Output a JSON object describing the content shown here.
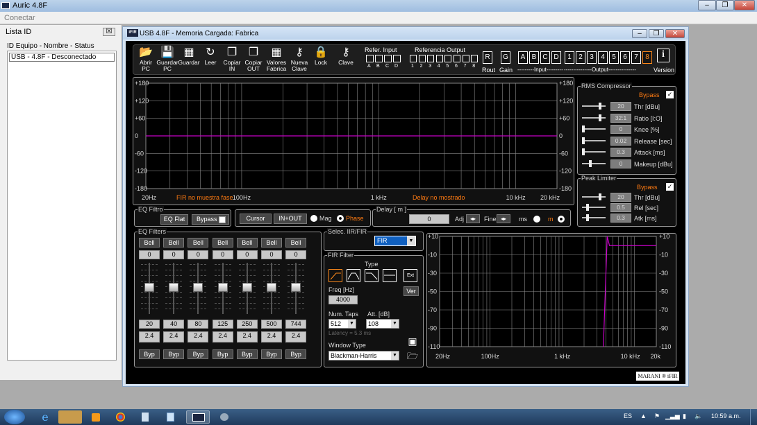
{
  "window": {
    "title": "Auric 4.8F",
    "menu": "Conectar"
  },
  "left_panel": {
    "title": "Lista ID",
    "close": "☒",
    "header": "ID Equipo - Nombre - Status",
    "item": "USB - 4.8F - Desconectado"
  },
  "main": {
    "title": "USB  4.8F  - Memoria Cargada: Fabrica"
  },
  "toolbar": {
    "buttons": [
      {
        "l1": "Abrir",
        "l2": "PC"
      },
      {
        "l1": "Guardar",
        "l2": "PC"
      },
      {
        "l1": "Guardar",
        "l2": ""
      },
      {
        "l1": "Leer",
        "l2": ""
      },
      {
        "l1": "Copiar",
        "l2": "IN"
      },
      {
        "l1": "Copiar",
        "l2": "OUT"
      },
      {
        "l1": "Valores",
        "l2": "Fabrica"
      },
      {
        "l1": "Nueva",
        "l2": "Clave"
      },
      {
        "l1": "Lock",
        "l2": ""
      },
      {
        "l1": "Clave",
        "l2": ""
      }
    ],
    "refer_input": "Refer. Input",
    "input_letters": [
      "A",
      "B",
      "C",
      "D"
    ],
    "ref_output": "Referencia Output",
    "output_numbers": [
      "1",
      "2",
      "3",
      "4",
      "5",
      "6",
      "7",
      "8"
    ],
    "rout": "Rout",
    "gain": "Gain",
    "rbtn": "R",
    "gbtn": "G",
    "in_btns": [
      "A",
      "B",
      "C",
      "D"
    ],
    "out_btns": [
      "1",
      "2",
      "3",
      "4",
      "5",
      "6",
      "7",
      "8"
    ],
    "input_label": "---------Input---------",
    "output_label": "---------------Output---------------",
    "version": "Version",
    "info": "i"
  },
  "phase_graph": {
    "y_left": [
      "+180",
      "+120",
      "+60",
      "0",
      "-60",
      "-120",
      "-180"
    ],
    "y_right": [
      "+180",
      "+120",
      "+60",
      "0",
      "-60",
      "-120",
      "-180"
    ],
    "x_labels": [
      "20Hz",
      "100Hz",
      "1 kHz",
      "10 kHz",
      "20 kHz"
    ],
    "note_fir": "FIR no muestra fase",
    "note_delay": "Delay no mostrado",
    "line_color": "#c800c8"
  },
  "eq_filtro": {
    "title": "EQ Filtro",
    "flat": "EQ Flat",
    "bypass": "Bypass"
  },
  "cursor": {
    "cursor": "Cursor",
    "inout": "IN+OUT",
    "mag": "Mag",
    "phase": "Phase"
  },
  "delay": {
    "title": "Delay [ m ]",
    "value": "0",
    "adj": "Adj",
    "fine": "Fine",
    "ms": "ms",
    "m": "m"
  },
  "rms": {
    "title": "RMS Compressor",
    "bypass": "Bypass",
    "rows": [
      {
        "value": "20",
        "label": "Thr [dBu]"
      },
      {
        "value": "32:1",
        "label": "Ratio [I:O]"
      },
      {
        "value": "0",
        "label": "Knee [%]"
      },
      {
        "value": "0.02",
        "label": "Release [sec]"
      },
      {
        "value": "0.3",
        "label": "Attack [ms]"
      },
      {
        "value": "0",
        "label": "Makeup [dBu]"
      }
    ]
  },
  "peak": {
    "title": "Peak Limiter",
    "bypass": "Bypass",
    "rows": [
      {
        "value": "20",
        "label": "Thr [dBu]"
      },
      {
        "value": "0.5",
        "label": "Rel [sec]"
      },
      {
        "value": "0.3",
        "label": "Atk [ms]"
      }
    ]
  },
  "eq_filters": {
    "title": "EQ Filters",
    "bands": [
      {
        "type": "Bell",
        "gain": "0",
        "freq": "20",
        "q": "2.4",
        "byp": "Byp"
      },
      {
        "type": "Bell",
        "gain": "0",
        "freq": "40",
        "q": "2.4",
        "byp": "Byp"
      },
      {
        "type": "Bell",
        "gain": "0",
        "freq": "80",
        "q": "2.4",
        "byp": "Byp"
      },
      {
        "type": "Bell",
        "gain": "0",
        "freq": "125",
        "q": "2.4",
        "byp": "Byp"
      },
      {
        "type": "Bell",
        "gain": "0",
        "freq": "250",
        "q": "2.4",
        "byp": "Byp"
      },
      {
        "type": "Bell",
        "gain": "0",
        "freq": "500",
        "q": "2.4",
        "byp": "Byp"
      },
      {
        "type": "Bell",
        "gain": "0",
        "freq": "744",
        "q": "2.4",
        "byp": "Byp"
      }
    ]
  },
  "selec": {
    "title": "Selec. IIR/FIR",
    "value": "FIR"
  },
  "fir": {
    "title": "FIR Filter",
    "type": "Type",
    "ext": "Ext",
    "freq_label": "Freq [Hz]",
    "freq": "4000",
    "ver": "Ver",
    "taps_label": "Num. Taps",
    "taps": "512",
    "att_label": "Att. [dB]",
    "att": "108",
    "latency": "Latency = 5.3 ms",
    "window_label": "Window Type",
    "window": "Blackman-Harris"
  },
  "mag_graph": {
    "y_left": [
      "+10",
      "-10",
      "-30",
      "-50",
      "-70",
      "-90",
      "-110"
    ],
    "y_right": [
      "+10",
      "-10",
      "-30",
      "-50",
      "-70",
      "-90",
      "-110"
    ],
    "x_labels": [
      "20Hz",
      "100Hz",
      "1 kHz",
      "10 kHz",
      "20k"
    ],
    "line_color": "#c800c8"
  },
  "brand": "MARANI ® iFIR",
  "taskbar": {
    "lang": "ES",
    "time": "10:59 a.m."
  }
}
